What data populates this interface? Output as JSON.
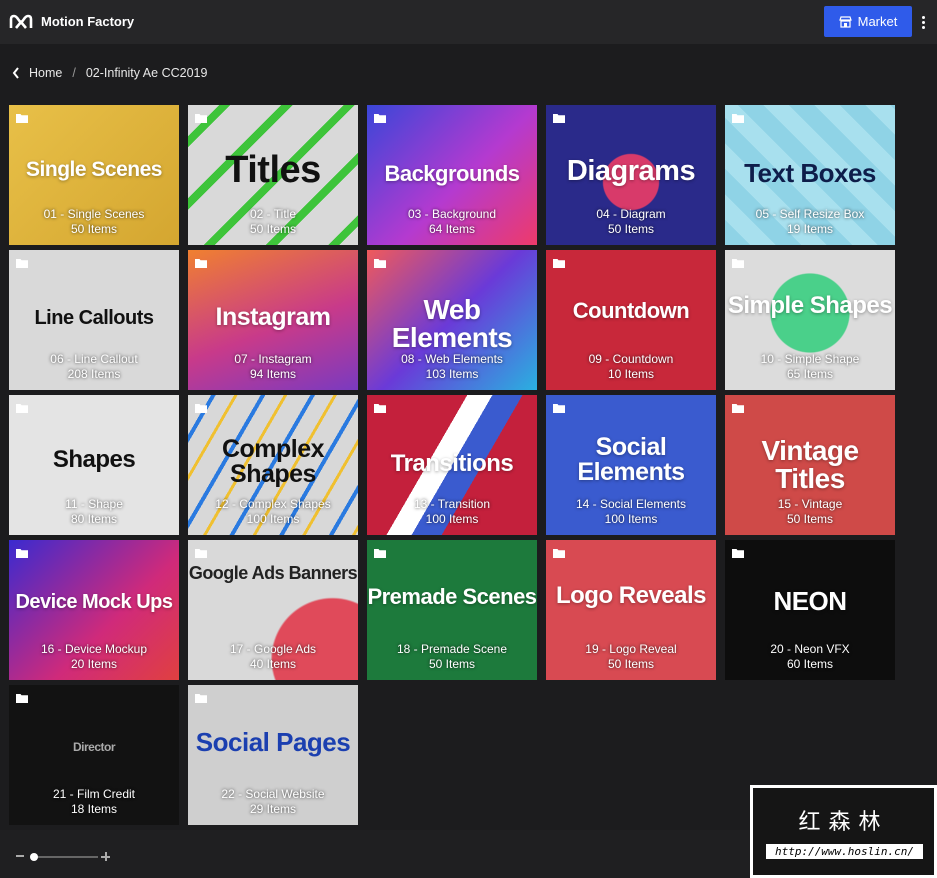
{
  "header": {
    "app_title": "Motion Factory",
    "market_label": "Market"
  },
  "breadcrumb": {
    "home": "Home",
    "separator": "/",
    "current": "02-Infinity Ae CC2019"
  },
  "tiles": [
    {
      "name": "01 - Single Scenes",
      "count": "50 Items",
      "art": "Single Scenes",
      "bg": "#e0b640",
      "fg": "#ffffff"
    },
    {
      "name": "02 - Title",
      "count": "50 Items",
      "art": "Titles",
      "bg": "#d7d7d7",
      "fg": "#111111"
    },
    {
      "name": "03 - Background",
      "count": "64 Items",
      "art": "Backgrounds",
      "bg": "#7a3cc7",
      "fg": "#ffffff"
    },
    {
      "name": "04 - Diagram",
      "count": "50 Items",
      "art": "Diagrams",
      "bg": "#2a2a8a",
      "fg": "#ffffff"
    },
    {
      "name": "05 - Self Resize Box",
      "count": "19 Items",
      "art": "Text Boxes",
      "bg": "#8fd3e6",
      "fg": "#0e1d4a"
    },
    {
      "name": "06 - Line Callout",
      "count": "208 Items",
      "art": "Line Callouts",
      "bg": "#d9d9d9",
      "fg": "#111111"
    },
    {
      "name": "07 - Instagram",
      "count": "94 Items",
      "art": "Instagram",
      "bg": "#c73a86",
      "fg": "#ffffff"
    },
    {
      "name": "08 - Web Elements",
      "count": "103 Items",
      "art": "Web Elements",
      "bg": "#4a3ab0",
      "fg": "#ffffff"
    },
    {
      "name": "09 - Countdown",
      "count": "10 Items",
      "art": "Countdown",
      "bg": "#c8283a",
      "fg": "#ffffff"
    },
    {
      "name": "10 - Simple Shape",
      "count": "65 Items",
      "art": "Simple Shapes",
      "bg": "#dcdcdc",
      "fg": "#ffffff"
    },
    {
      "name": "11 - Shape",
      "count": "80 Items",
      "art": "Shapes",
      "bg": "#e4e4e4",
      "fg": "#111111"
    },
    {
      "name": "12 - Complex Shapes",
      "count": "100 Items",
      "art": "Complex Shapes",
      "bg": "#d8d8d8",
      "fg": "#111111"
    },
    {
      "name": "13 - Transition",
      "count": "100 Items",
      "art": "Transitions",
      "bg": "#c4203c",
      "fg": "#ffffff"
    },
    {
      "name": "14 - Social Elements",
      "count": "100 Items",
      "art": "Social Elements",
      "bg": "#3a5bcf",
      "fg": "#ffffff"
    },
    {
      "name": "15 - Vintage",
      "count": "50 Items",
      "art": "Vintage Titles",
      "bg": "#cf4a48",
      "fg": "#ffffff"
    },
    {
      "name": "16 - Device Mockup",
      "count": "20 Items",
      "art": "Device Mock Ups",
      "bg": "#7a2d6e",
      "fg": "#ffffff"
    },
    {
      "name": "17 - Google Ads",
      "count": "40 Items",
      "art": "Google Ads Banners",
      "bg": "#d9d9d9",
      "fg": "#222222"
    },
    {
      "name": "18 - Premade Scene",
      "count": "50 Items",
      "art": "Premade Scenes",
      "bg": "#1d7a3c",
      "fg": "#ffffff"
    },
    {
      "name": "19 - Logo Reveal",
      "count": "50 Items",
      "art": "Logo Reveals",
      "bg": "#d84a52",
      "fg": "#ffffff"
    },
    {
      "name": "20 - Neon VFX",
      "count": "60 Items",
      "art": "NEON",
      "bg": "#0d0d0d",
      "fg": "#ffffff"
    },
    {
      "name": "21 - Film Credit",
      "count": "18 Items",
      "art": "Director",
      "bg": "#121212",
      "fg": "#aaaaaa"
    },
    {
      "name": "22 - Social Website",
      "count": "29 Items",
      "art": "Social Pages",
      "bg": "#cfcfcf",
      "fg": "#1b3fb0"
    }
  ],
  "watermark": {
    "cn": "红森林",
    "url": "http://www.hoslin.cn/"
  },
  "colors": {
    "accent": "#2f5bea",
    "background": "#1c1c1e"
  }
}
